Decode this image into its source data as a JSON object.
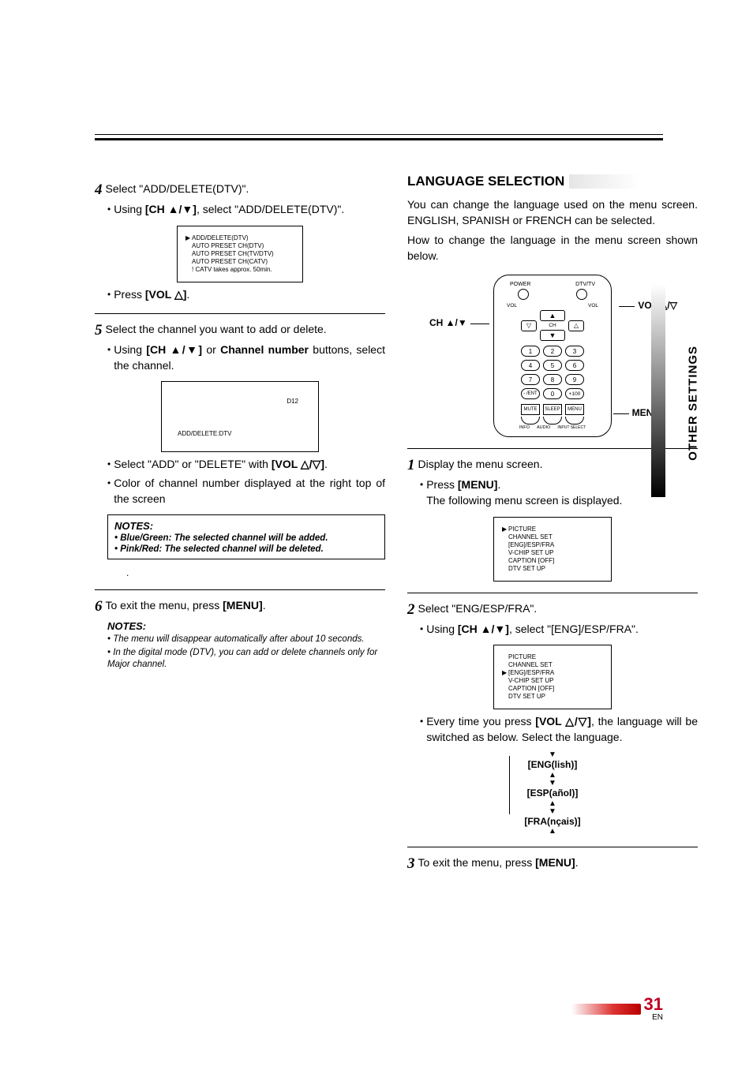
{
  "left": {
    "step4": {
      "text": "Select \"ADD/DELETE(DTV)\".",
      "bullet_pre": "Using ",
      "bullet_bold": "[CH ▲/▼]",
      "bullet_post": ", select \"ADD/DELETE(DTV)\".",
      "menu": {
        "l1": "ADD/DELETE(DTV)",
        "l2": "AUTO PRESET CH(DTV)",
        "l3": "AUTO PRESET CH(TV/DTV)",
        "l4": "AUTO PRESET CH(CATV)",
        "l5": "! CATV takes approx. 50min."
      },
      "press_pre": "Press ",
      "press_bold": "[VOL △]",
      "press_post": "."
    },
    "step5": {
      "text": "Select the channel you want to add or delete.",
      "b1_pre": "Using ",
      "b1_bold1": "[CH ▲/▼]",
      "b1_mid": " or ",
      "b1_bold2": "Channel number",
      "b1_post": " buttons, select the channel.",
      "chan_d": "D12",
      "chan_ad": "ADD/DELETE:DTV",
      "b2_pre": "Select \"ADD\" or \"DELETE\" with ",
      "b2_bold": "[VOL △/▽]",
      "b2_post": ".",
      "b3": "Color of channel number displayed at the right top of the screen"
    },
    "notesbox": {
      "hdr": "NOTES:",
      "n1": "• Blue/Green: The selected channel will be added.",
      "n2": "• Pink/Red: The selected channel will be deleted."
    },
    "dot": ".",
    "step6": {
      "pre": "To exit the menu, press ",
      "bold": "[MENU]",
      "post": "."
    },
    "notesplain": {
      "hdr": "NOTES:",
      "n1": "• The menu will disappear automatically after about 10 seconds.",
      "n2": "• In the digital mode (DTV), you can add or delete channels only for Major channel."
    }
  },
  "right": {
    "heading": "LANGUAGE SELECTION",
    "para1": "You can change the language used on the menu screen. ENGLISH, SPANISH or FRENCH can be selected.",
    "para2": "How to change the language in the menu screen shown below.",
    "callout_vol": "VOL △/▽",
    "callout_ch": "CH ▲/▼",
    "callout_menu": "MENU",
    "remote": {
      "top_l": "POWER",
      "top_r": "DTV/TV",
      "v_l": "VOL",
      "v_r": "VOL",
      "ch": "CH",
      "n1": "1",
      "n2": "2",
      "n3": "3",
      "n4": "4",
      "n5": "5",
      "n6": "6",
      "n7": "7",
      "n8": "8",
      "n9": "9",
      "nm": "- /ENT",
      "n0": "0",
      "np": "+100",
      "s1": "MUTE",
      "s2": "SLEEP",
      "s3": "MENU",
      "a1": "INFO",
      "a2": "AUDIO",
      "a3": "INPUT SELECT"
    },
    "step1": {
      "text": "Display the menu screen.",
      "b_pre": "Press ",
      "b_bold": "[MENU]",
      "b_post": ".",
      "line2": "The following menu screen is displayed.",
      "menu": {
        "l1": "PICTURE",
        "l2": "CHANNEL SET",
        "l3": "[ENG]/ESP/FRA",
        "l4": "V-CHIP SET UP",
        "l5": "CAPTION [OFF]",
        "l6": "DTV SET UP"
      }
    },
    "step2": {
      "text": "Select \"ENG/ESP/FRA\".",
      "b_pre": "Using ",
      "b_bold": "[CH ▲/▼]",
      "b_post": ", select \"[ENG]/ESP/FRA\".",
      "menu": {
        "l1": "PICTURE",
        "l2": "CHANNEL SET",
        "l3": "[ENG]/ESP/FRA",
        "l4": "V-CHIP SET UP",
        "l5": "CAPTION [OFF]",
        "l6": "DTV SET UP"
      },
      "every_pre": "Every time you press ",
      "every_bold": "[VOL △/▽]",
      "every_post": ", the language will be switched as below. Select the language.",
      "opt1": "[ENG(lish)]",
      "opt2": "[ESP(añol)]",
      "opt3": "[FRA(nçais)]"
    },
    "step3": {
      "pre": "To exit the menu, press ",
      "bold": "[MENU]",
      "post": "."
    }
  },
  "side": "OTHER SETTINGS",
  "footer": {
    "page": "31",
    "en": "EN"
  }
}
